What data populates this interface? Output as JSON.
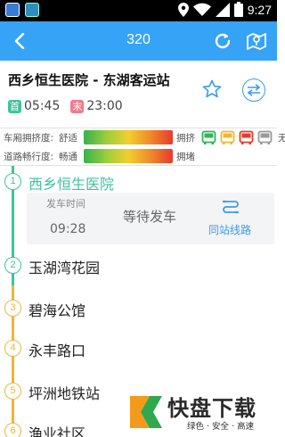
{
  "status_bar": {
    "time": "9:27"
  },
  "header": {
    "title": "320"
  },
  "route": {
    "name": "西乡恒生医院 - 东湖客运站",
    "first_tag": "首",
    "first_time": "05:45",
    "last_tag": "末",
    "last_time": "23:00"
  },
  "legend": {
    "crowd_label": "车厢拥挤度:",
    "crowd_min": "舒适",
    "crowd_max": "拥挤",
    "bus_none": "无数",
    "road_label": "道路畅行度:",
    "road_min": "畅通",
    "road_max": "拥堵",
    "bus_colors": [
      "#2fb55a",
      "#f2b82c",
      "#e8392c",
      "#9a9a9a"
    ]
  },
  "stations": [
    {
      "num": "1",
      "name": "西乡恒生医院",
      "current": true
    },
    {
      "num": "2",
      "name": "玉湖湾花园"
    },
    {
      "num": "3",
      "name": "碧海公馆"
    },
    {
      "num": "4",
      "name": "永丰路口"
    },
    {
      "num": "5",
      "name": "坪洲地铁站"
    },
    {
      "num": "6",
      "name": "渔业社区"
    }
  ],
  "wait_card": {
    "label": "发车时间",
    "time": "09:28",
    "status": "等待发车",
    "link": "同站线路"
  },
  "watermark": {
    "text": "快盘下载",
    "sub": "绿色 · 安全 · 高速"
  },
  "colors": {
    "header": "#36a3f7",
    "accent_green": "#3ec39a",
    "accent_yellow": "#efb43a"
  }
}
